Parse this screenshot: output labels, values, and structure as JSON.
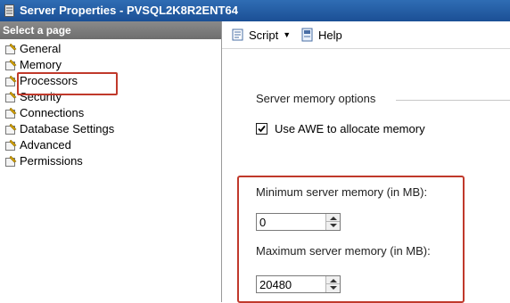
{
  "window": {
    "title": "Server Properties - PVSQL2K8R2ENT64"
  },
  "sidebar": {
    "header": "Select a page",
    "items": [
      {
        "label": "General",
        "icon": "page-wrench-icon"
      },
      {
        "label": "Memory",
        "icon": "page-wrench-icon",
        "selected": true
      },
      {
        "label": "Processors",
        "icon": "page-wrench-icon"
      },
      {
        "label": "Security",
        "icon": "page-wrench-icon"
      },
      {
        "label": "Connections",
        "icon": "page-wrench-icon"
      },
      {
        "label": "Database Settings",
        "icon": "page-wrench-icon"
      },
      {
        "label": "Advanced",
        "icon": "page-wrench-icon"
      },
      {
        "label": "Permissions",
        "icon": "page-wrench-icon"
      }
    ]
  },
  "toolbar": {
    "script_label": "Script",
    "help_label": "Help"
  },
  "memory": {
    "group_label": "Server memory options",
    "awe_label": "Use AWE to allocate memory",
    "awe_checked": true,
    "min_label": "Minimum server memory (in MB):",
    "min_value": "0",
    "max_label": "Maximum server memory (in MB):",
    "max_value": "20480"
  },
  "colors": {
    "titlebar": "#1b4f95",
    "highlight": "#c0392b",
    "sidebar_header": "#7a7a7a"
  }
}
